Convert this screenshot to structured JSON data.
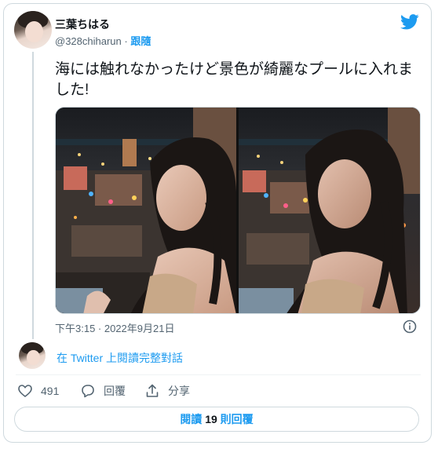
{
  "header": {
    "display_name": "三葉ちはる",
    "handle": "@328chiharun",
    "separator": " · ",
    "follow_label": "跟隨",
    "logo_icon": "twitter-bird-icon"
  },
  "tweet": {
    "text": "海には触れなかったけど景色が綺麗なプールに入れました!",
    "timestamp": "下午3:15 · 2022年9月21日",
    "photos": [
      "night-city-pool-photo-1",
      "night-city-pool-photo-2"
    ]
  },
  "conversation": {
    "link_label": "在 Twitter 上閱讀完整對話"
  },
  "actions": {
    "like_count": "491",
    "reply_label": "回覆",
    "share_label": "分享"
  },
  "read_replies": {
    "prefix": "閱讀 ",
    "count": "19",
    "suffix": " 則回覆"
  },
  "colors": {
    "accent": "#1d9bf0",
    "text": "#0f1419",
    "muted": "#536471",
    "border": "#cfd9de"
  }
}
